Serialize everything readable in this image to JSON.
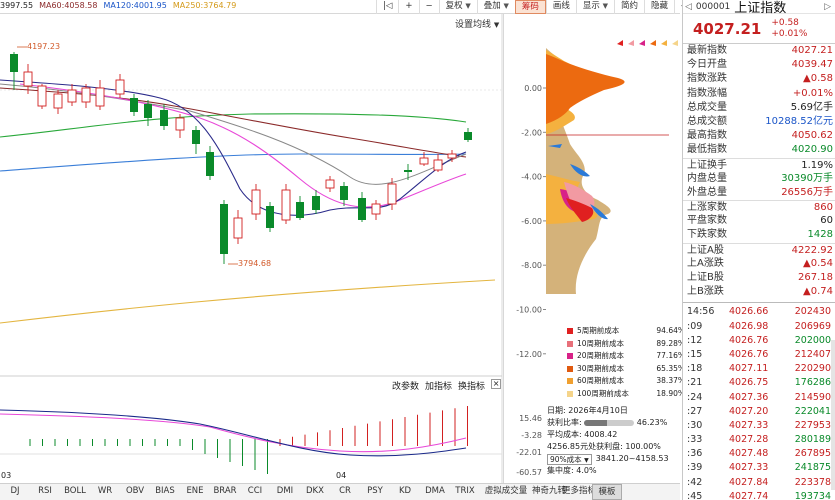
{
  "ma_legend": [
    {
      "label": "3997.55",
      "color": "#222222"
    },
    {
      "label": "MA60:4058.58",
      "color": "#8b2a2a"
    },
    {
      "label": "MA120:4001.95",
      "color": "#1a55c8"
    },
    {
      "label": "MA250:3764.79",
      "color": "#d49a1a"
    }
  ],
  "toolbar": {
    "prev": "|◁",
    "plus": "+",
    "minus": "−",
    "restore": "复权",
    "overlay": "叠加",
    "chips": "筹码",
    "draw": "画线",
    "display": "显示",
    "simple": "简约",
    "hide": "隐藏",
    "fold": "◁"
  },
  "setting_label": "设置均线",
  "price_axis": [
    "0.00",
    "-2.00",
    "-4.00",
    "-6.00",
    "-8.00",
    "-10.00",
    "-12.00"
  ],
  "high_label": "4197.23",
  "low_label": "3794.68",
  "sub_axis": [
    "15.46",
    "-3.28",
    "-22.01",
    "-60.57"
  ],
  "sub_buttons": {
    "params": "改参数",
    "add": "加指标",
    "swap": "换指标",
    "close": "×"
  },
  "date_labels": {
    "d1": "03",
    "d2": "04"
  },
  "bottom_tabs": [
    "DJ",
    "RSI",
    "BOLL",
    "WR",
    "OBV",
    "BIAS",
    "ENE",
    "BRAR",
    "CCI",
    "DMI",
    "DKX",
    "CR",
    "PSY",
    "KD",
    "DMA",
    "TRIX",
    "虚拟成交量",
    "神奇九转",
    "更多指标",
    "模板"
  ],
  "cost_legend": [
    {
      "name": "5周期前成本",
      "value": "94.64%",
      "color": "#e02020"
    },
    {
      "name": "10周期前成本",
      "value": "89.28%",
      "color": "#e8707a"
    },
    {
      "name": "20周期前成本",
      "value": "77.16%",
      "color": "#d82288"
    },
    {
      "name": "30周期前成本",
      "value": "65.35%",
      "color": "#e05a10"
    },
    {
      "name": "60周期前成本",
      "value": "38.37%",
      "color": "#f0a030"
    },
    {
      "name": "100周期前成本",
      "value": "18.90%",
      "color": "#f5d48a"
    }
  ],
  "cost_info": {
    "date": "日期: 2026年4月10日",
    "profit_label": "获利比率:",
    "profit_ratio": 0.4623,
    "profit_value": "46.23%",
    "avg_cost": "平均成本: 4008.42",
    "profit_cost": "4256.85元处获利盘: 100.00%",
    "select": "90%成本",
    "range": "3841.20~4158.53",
    "concentration": "集中度: 4.0%"
  },
  "quote": {
    "code": "000001",
    "name": "上证指数",
    "price": "4027.21",
    "change": "+0.58",
    "change_pct": "+0.01%",
    "rows": [
      {
        "label": "最新指数",
        "value": "4027.21",
        "cls": "red"
      },
      {
        "label": "今日开盘",
        "value": "4039.47",
        "cls": "red"
      },
      {
        "label": "指数涨跌",
        "value": "▲0.58",
        "cls": "red"
      },
      {
        "label": "指数涨幅",
        "value": "+0.01%",
        "cls": "red"
      },
      {
        "label": "总成交量",
        "value": "5.69亿手",
        "cls": ""
      },
      {
        "label": "总成交额",
        "value": "10288.52亿元",
        "cls": "blu"
      },
      {
        "label": "最高指数",
        "value": "4050.62",
        "cls": "red"
      },
      {
        "label": "最低指数",
        "value": "4020.90",
        "cls": "grn"
      },
      {
        "label": "上证换手",
        "value": "1.19%",
        "cls": "",
        "sep": true
      },
      {
        "label": "内盘总量",
        "value": "30390万手",
        "cls": "grn"
      },
      {
        "label": "外盘总量",
        "value": "26556万手",
        "cls": "red"
      },
      {
        "label": "上涨家数",
        "value": "860",
        "cls": "red",
        "sep": true
      },
      {
        "label": "平盘家数",
        "value": "60",
        "cls": ""
      },
      {
        "label": "下跌家数",
        "value": "1428",
        "cls": "grn"
      },
      {
        "label": "上证A股",
        "value": "4222.92",
        "cls": "red",
        "sep": true
      },
      {
        "label": "上A涨跌",
        "value": "▲0.54",
        "cls": "red"
      },
      {
        "label": "上证B股",
        "value": "267.18",
        "cls": "red"
      },
      {
        "label": "上B涨跌",
        "value": "▲0.74",
        "cls": "red"
      }
    ],
    "ticks": [
      {
        "t": "14:56",
        "p": "4026.66",
        "v": "202430",
        "cls": "red"
      },
      {
        "t": ":09",
        "p": "4026.98",
        "v": "206969",
        "cls": "red"
      },
      {
        "t": ":12",
        "p": "4026.76",
        "v": "202000",
        "cls": "grn"
      },
      {
        "t": ":15",
        "p": "4026.76",
        "v": "212407",
        "cls": "red"
      },
      {
        "t": ":18",
        "p": "4027.11",
        "v": "220290",
        "cls": "red"
      },
      {
        "t": ":21",
        "p": "4026.75",
        "v": "176286",
        "cls": "grn"
      },
      {
        "t": ":24",
        "p": "4027.36",
        "v": "214590",
        "cls": "red"
      },
      {
        "t": ":27",
        "p": "4027.20",
        "v": "222041",
        "cls": "grn"
      },
      {
        "t": ":30",
        "p": "4027.33",
        "v": "227953",
        "cls": "red"
      },
      {
        "t": ":33",
        "p": "4027.28",
        "v": "280189",
        "cls": "grn"
      },
      {
        "t": ":36",
        "p": "4027.48",
        "v": "267895",
        "cls": "red"
      },
      {
        "t": ":39",
        "p": "4027.33",
        "v": "241875",
        "cls": "grn"
      },
      {
        "t": ":42",
        "p": "4027.84",
        "v": "223378",
        "cls": "red"
      },
      {
        "t": ":45",
        "p": "4027.74",
        "v": "193734",
        "cls": "grn"
      }
    ]
  }
}
